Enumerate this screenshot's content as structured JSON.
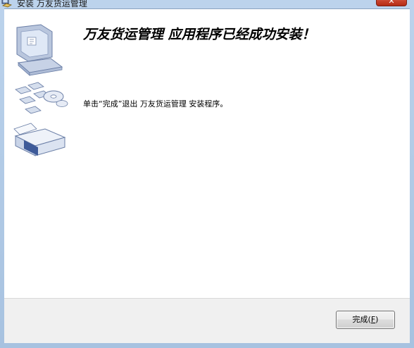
{
  "window": {
    "title": "安装 万友货运管理"
  },
  "main": {
    "heading": "万友货运管理 应用程序已经成功安装！",
    "message": "单击“完成”退出 万友货运管理 安装程序。"
  },
  "footer": {
    "finish_label": "完成(",
    "finish_mnemonic": "F",
    "finish_suffix": ")"
  }
}
